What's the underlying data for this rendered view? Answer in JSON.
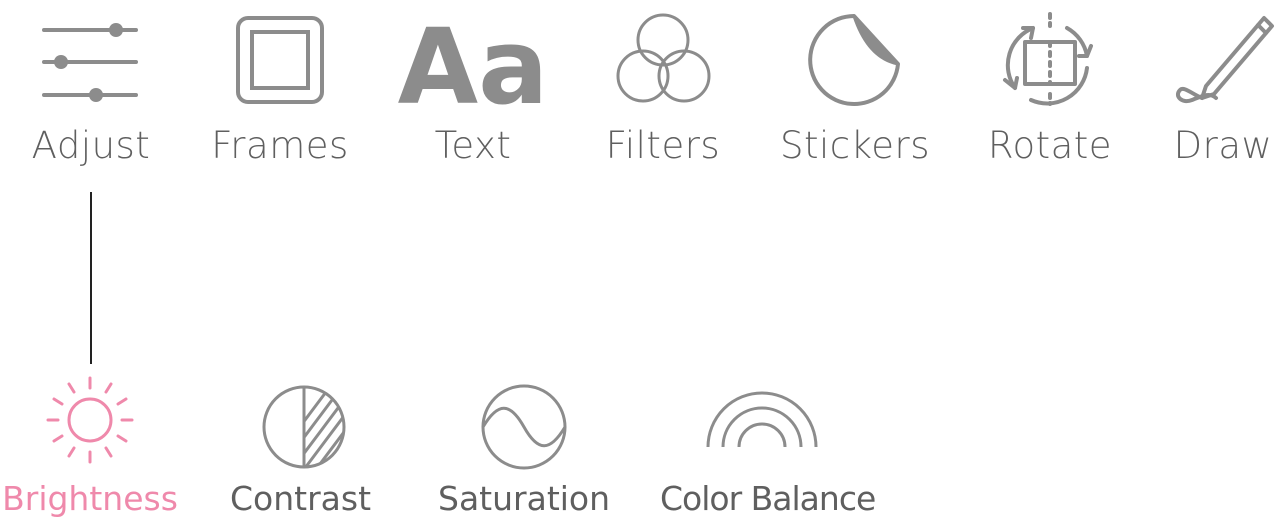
{
  "toolbar": {
    "tools": [
      {
        "label": "Adjust",
        "icon": "sliders-icon"
      },
      {
        "label": "Frames",
        "icon": "frame-icon"
      },
      {
        "label": "Text",
        "icon": "text-aa-icon",
        "glyph": "Aa"
      },
      {
        "label": "Filters",
        "icon": "filters-circles-icon"
      },
      {
        "label": "Stickers",
        "icon": "sticker-peel-icon"
      },
      {
        "label": "Rotate",
        "icon": "rotate-icon"
      },
      {
        "label": "Draw",
        "icon": "pencil-icon"
      }
    ]
  },
  "adjust_options": {
    "selected": "Brightness",
    "items": [
      {
        "label": "Brightness",
        "icon": "sun-icon"
      },
      {
        "label": "Contrast",
        "icon": "contrast-icon"
      },
      {
        "label": "Saturation",
        "icon": "saturation-wave-icon"
      },
      {
        "label": "Color Balance",
        "icon": "color-balance-arcs-icon"
      }
    ]
  },
  "colors": {
    "icon_gray": "#8c8c8c",
    "label_gray": "#5f5f5f",
    "active_pink": "#ef89ab",
    "connector": "#222222"
  }
}
